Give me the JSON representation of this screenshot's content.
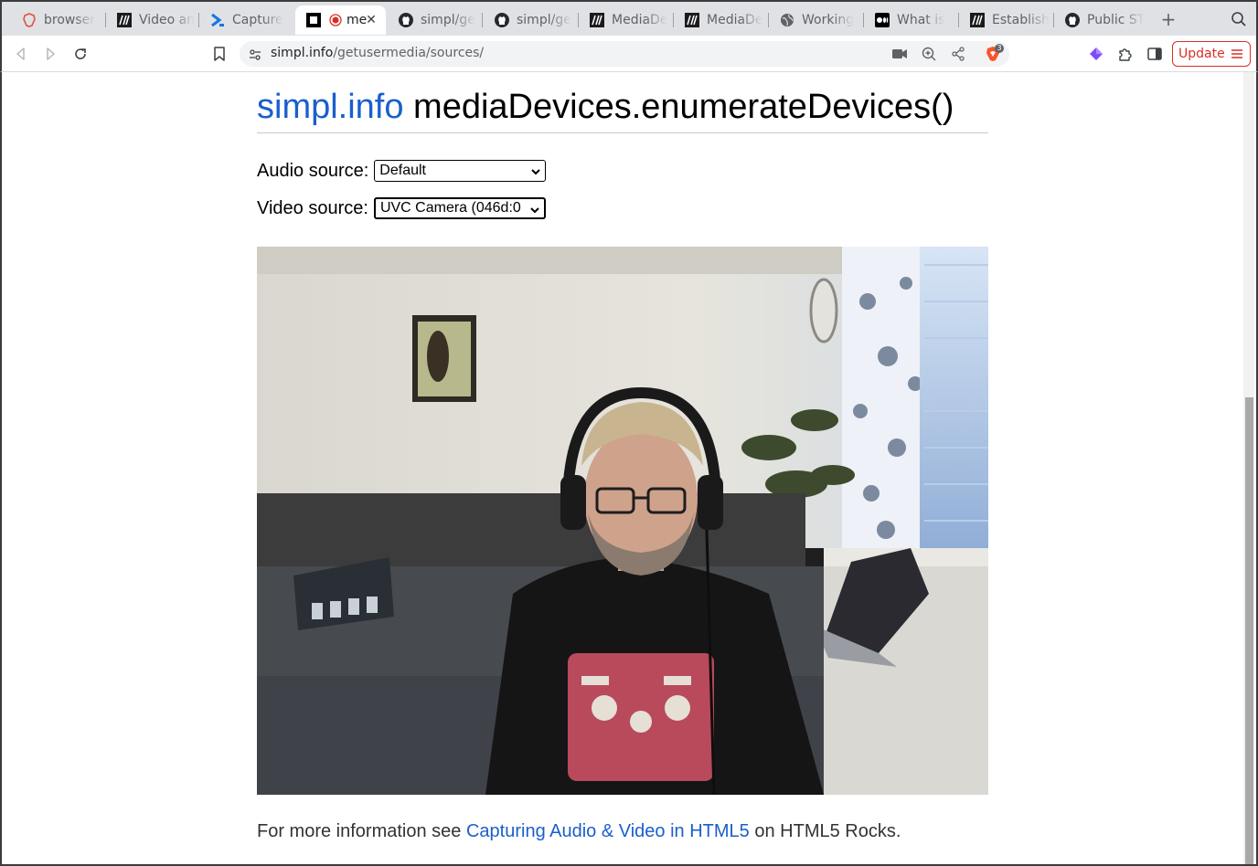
{
  "browser": {
    "tabs": [
      {
        "title": "browser",
        "icon": "brave-lion-icon",
        "active": false
      },
      {
        "title": "Video an",
        "icon": "mdn-icon",
        "active": false
      },
      {
        "title": "Capture",
        "icon": "chevron-app-icon",
        "active": false
      },
      {
        "title": "me",
        "icon": "page-recording-icon",
        "active": true
      },
      {
        "title": "simpl/ge",
        "icon": "github-icon",
        "active": false
      },
      {
        "title": "simpl/ge",
        "icon": "github-icon",
        "active": false
      },
      {
        "title": "MediaDe",
        "icon": "mdn-icon",
        "active": false
      },
      {
        "title": "MediaDe",
        "icon": "mdn-icon",
        "active": false
      },
      {
        "title": "Working",
        "icon": "globe-icon",
        "active": false
      },
      {
        "title": "What is",
        "icon": "medium-icon",
        "active": false
      },
      {
        "title": "Establish",
        "icon": "mdn-icon",
        "active": false
      },
      {
        "title": "Public ST",
        "icon": "github-icon",
        "active": false
      }
    ],
    "url_host": "simpl.info",
    "url_path": "/getusermedia/sources/",
    "shields_badge": "3",
    "update_label": "Update",
    "colors": {
      "update": "#d93025",
      "link": "#1a5fcc",
      "tabstrip": "#dfe1e5"
    }
  },
  "page": {
    "title_link": "simpl.info",
    "title_rest": " mediaDevices.enumerateDevices()",
    "audio_label": "Audio source:",
    "audio_value": "Default",
    "video_label": "Video source:",
    "video_value": "UVC Camera (046d:0",
    "footer_before": "For more information see ",
    "footer_link": "Capturing Audio & Video in HTML5",
    "footer_after": " on HTML5 Rocks."
  }
}
